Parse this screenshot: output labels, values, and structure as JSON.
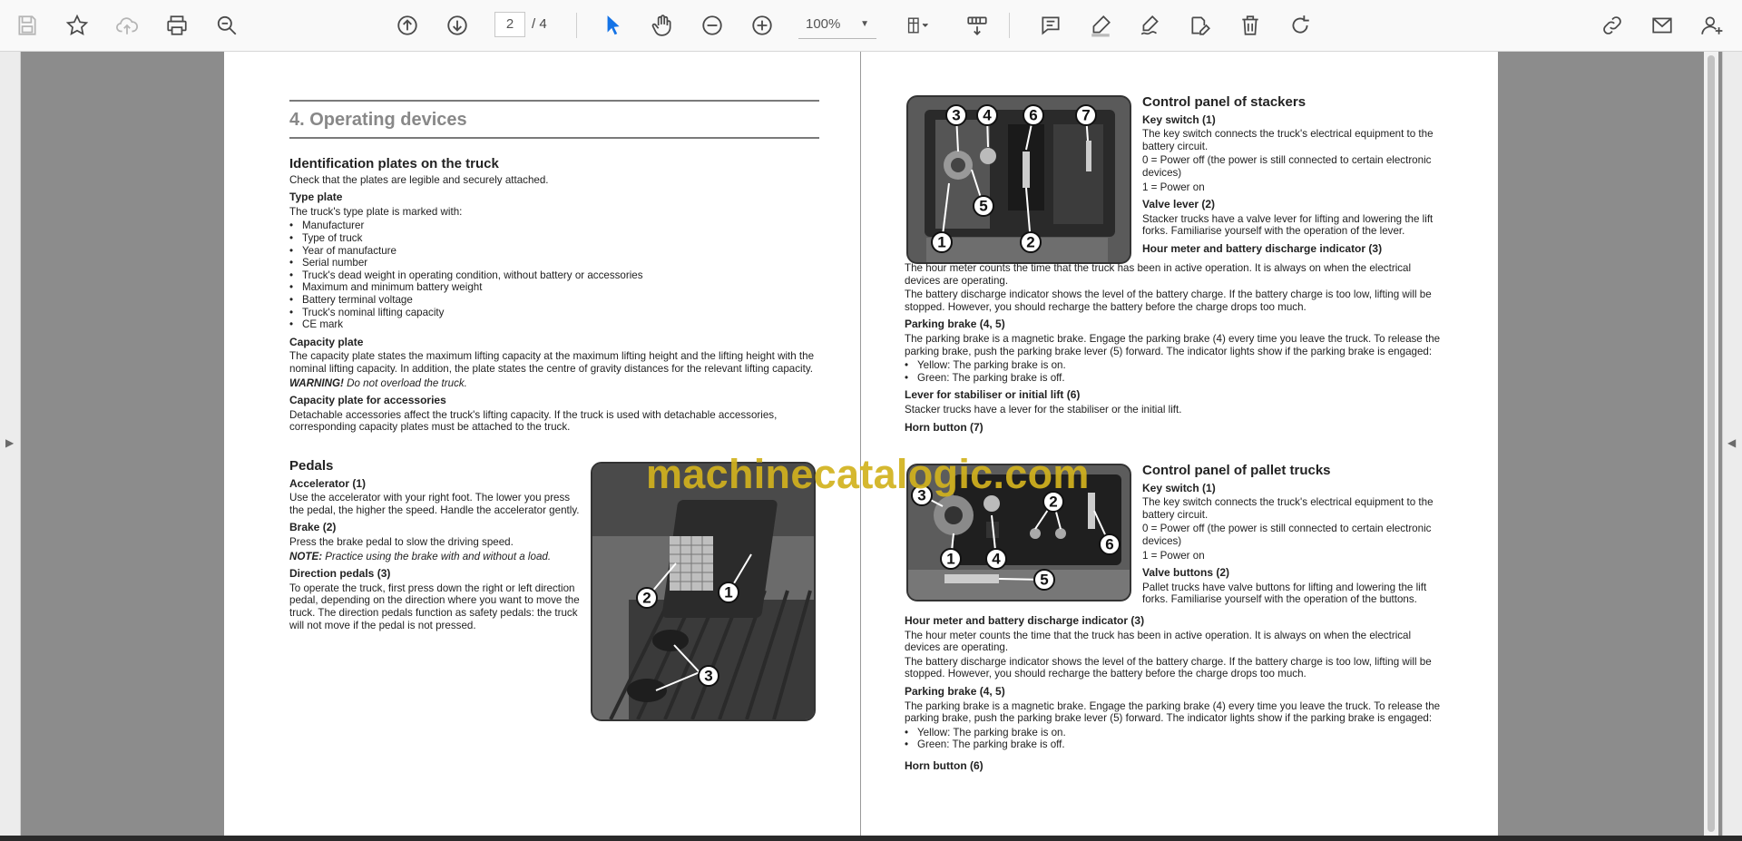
{
  "toolbar": {
    "page_current": "2",
    "page_total": "/ 4",
    "zoom": "100%"
  },
  "left_page": {
    "chapter": "4.  Operating devices",
    "ident_title": "Identification plates on the truck",
    "ident_text": "Check that the plates are legible and securely attached.",
    "type_plate_title": "Type plate",
    "type_plate_intro": "The truck's type plate is marked with:",
    "type_plate_items": [
      "Manufacturer",
      "Type of truck",
      "Year of manufacture",
      "Serial number",
      "Truck's dead weight in operating condition, without battery or accessories",
      "Maximum and minimum battery weight",
      "Battery terminal voltage",
      "Truck's nominal lifting capacity",
      "CE mark"
    ],
    "capacity_title": "Capacity plate",
    "capacity_text": "The capacity plate states the maximum lifting capacity at the maximum lifting height and the lifting height with the nominal lifting capacity. In addition, the plate states the centre of gravity distances for the relevant lifting capacity.",
    "warning_label": "WARNING!",
    "warning_text": " Do not overload the truck.",
    "acc_title": "Capacity plate for accessories",
    "acc_text": "Detachable accessories affect the truck's lifting capacity. If the truck is used with detachable accessories, corresponding capacity plates must be attached to the truck.",
    "pedals_title": "Pedals",
    "accel_title": "Accelerator (1)",
    "accel_text": "Use the accelerator with your right foot. The lower you press the pedal, the higher the speed. Handle the accelerator gently.",
    "brake_title": "Brake (2)",
    "brake_text": "Press the brake pedal to slow the driving speed.",
    "note_label": "NOTE:",
    "note_text": " Practice using the brake with and without a load.",
    "dir_title": "Direction pedals (3)",
    "dir_text": "To operate the truck, first press down the right or left direction pedal, depending on the direction where you want to move the truck. The direction pedals function as safety pedals: the truck will not move if the pedal is not pressed.",
    "photo_callouts": [
      "2",
      "1",
      "3"
    ]
  },
  "right_page": {
    "stackers_title": "Control panel of stackers",
    "key_switch_title": "Key switch (1)",
    "key_switch_text": "The key switch connects the truck's electrical equipment to the battery circuit.",
    "key_off": "0 = Power off (the power is still connected to certain electronic devices)",
    "key_on": "1 = Power on",
    "valve_lever_title": "Valve lever (2)",
    "valve_lever_text": "Stacker trucks have a valve lever for lifting and lowering the lift forks. Familiarise yourself with the operation of the lever.",
    "hour_meter_title": "Hour meter and battery discharge indicator (3)",
    "hour_meter_text": "The hour meter counts the time that the truck has been in active operation. It is always on when the electrical devices are operating.",
    "battery_text": "The battery discharge indicator shows the level of the battery charge. If the battery charge is too low, lifting will be stopped. However, you should recharge the battery before the charge drops too much.",
    "parking_title": "Parking brake (4, 5)",
    "parking_text": "The parking brake is a magnetic brake. Engage  the parking brake (4) every time you leave the truck. To release the parking brake, push the parking brake lever (5) forward. The indicator lights show if the parking brake is engaged:",
    "parking_items": [
      "Yellow: The parking brake is on.",
      "Green: The parking brake is off."
    ],
    "stabiliser_title": "Lever for stabiliser or initial lift (6)",
    "stabiliser_text": "Stacker trucks have a lever for the stabiliser or the initial lift.",
    "horn7_title": "Horn button (7)",
    "pallet_title": "Control panel of pallet trucks",
    "key_switch2_title": "Key switch (1)",
    "key_switch2_text": "The key switch connects the truck's electrical equipment to the battery circuit.",
    "key2_off": "0 = Power off (the power is still connected to certain electronic devices)",
    "key2_on": "1 = Power on",
    "valve_buttons_title": "Valve buttons (2)",
    "valve_buttons_text": "Pallet trucks have valve buttons for lifting and lowering the lift forks. Familiarise yourself with the operation of the buttons.",
    "hour2_title": "Hour meter and battery discharge indicator (3)",
    "hour2_text": "The hour meter counts the time that the truck has been in active operation. It is always on when the electrical devices are operating.",
    "battery2_text": "The battery discharge indicator shows the level of the battery charge. If the battery charge is too low, lifting will be stopped. However, you should recharge the battery before the charge drops too much.",
    "parking2_title": "Parking brake (4, 5)",
    "parking2_text": "The parking brake is a magnetic brake. Engage  the parking brake (4) every time you leave the truck. To release the parking brake, push the parking brake lever (5) forward. The indicator lights show if the parking brake is engaged:",
    "parking2_items": [
      "Yellow: The parking brake is on.",
      "Green: The parking brake is off."
    ],
    "horn6_title": "Horn button (6)",
    "stacker_callouts": [
      "3",
      "4",
      "6",
      "7",
      "5",
      "1",
      "2"
    ],
    "pallet_callouts": [
      "3",
      "2",
      "1",
      "4",
      "6",
      "5"
    ]
  },
  "watermark": "machinecatalogic.com"
}
